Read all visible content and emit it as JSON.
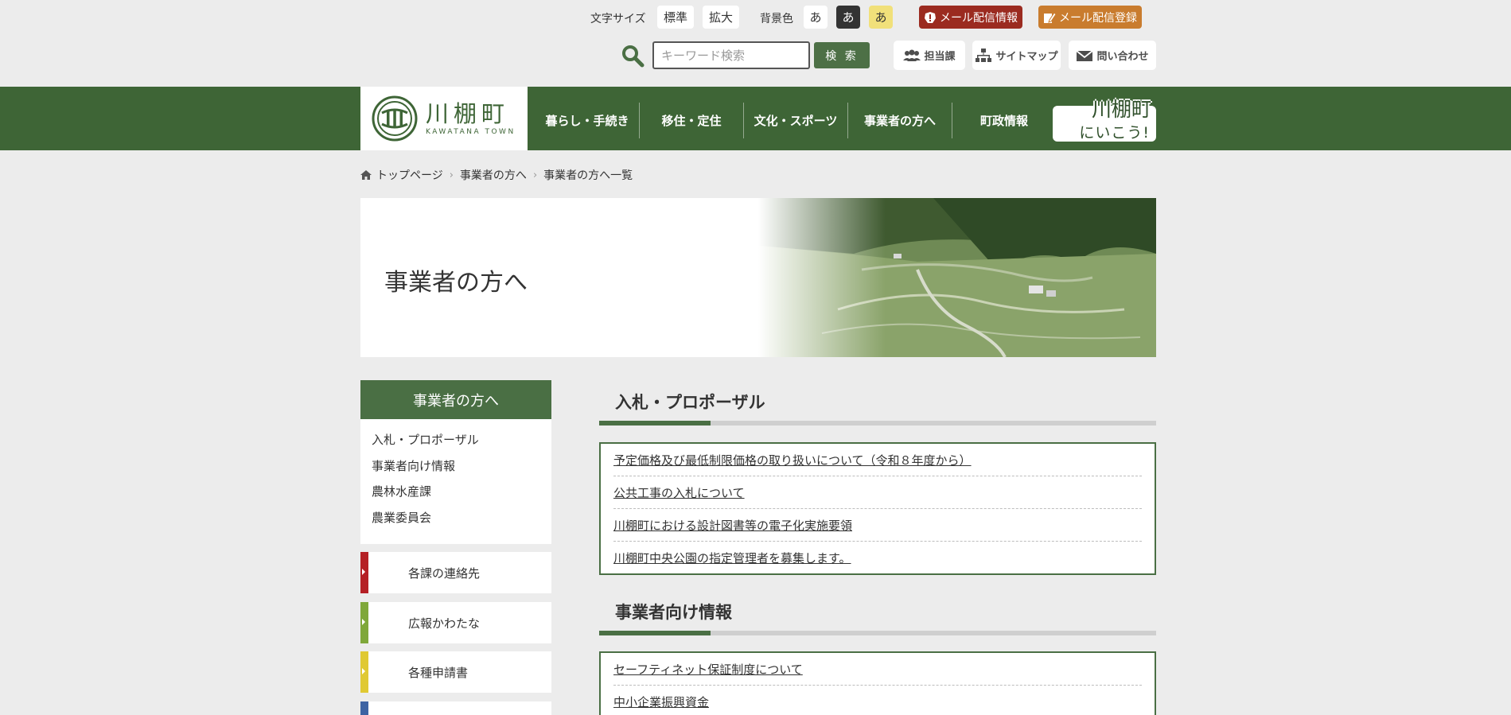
{
  "utility": {
    "font_size_label": "文字サイズ",
    "font_standard": "標準",
    "font_large": "拡大",
    "bg_color_label": "背景色",
    "bg_options": [
      "あ",
      "あ",
      "あ"
    ],
    "mail_info": "メール配信情報",
    "mail_register": "メール配信登録",
    "search_placeholder": "キーワード検索",
    "search_button": "検 索",
    "tools": [
      "担当課",
      "サイトマップ",
      "問い合わせ"
    ]
  },
  "logo": {
    "ja": "川棚町",
    "en": "KAWATANA TOWN"
  },
  "nav": {
    "items": [
      "暮らし・手続き",
      "移住・定住",
      "文化・スポーツ",
      "事業者の方へ",
      "町政情報"
    ],
    "banner_line1": "川棚町",
    "banner_line2": "にいこう!"
  },
  "breadcrumb": [
    "トップページ",
    "事業者の方へ",
    "事業者の方へ一覧"
  ],
  "hero": {
    "title": "事業者の方へ"
  },
  "sidebar": {
    "heading": "事業者の方へ",
    "items": [
      "入札・プロポーザル",
      "事業者向け情報",
      "農林水産課",
      "農業委員会"
    ],
    "boxes": [
      {
        "label": "各課の連絡先",
        "color": "#b52025"
      },
      {
        "label": "広報かわたな",
        "color": "#7fa83a"
      },
      {
        "label": "各種申請書",
        "color": "#e0c933"
      },
      {
        "label": "",
        "color": "#3d63a3"
      }
    ]
  },
  "sections": [
    {
      "title": "入札・プロポーザル",
      "links": [
        "予定価格及び最低制限価格の取り扱いについて（令和８年度から）",
        "公共工事の入札について",
        "川棚町における設計図書等の電子化実施要領",
        "川棚町中央公園の指定管理者を募集します。"
      ]
    },
    {
      "title": "事業者向け情報",
      "links": [
        "セーフティネット保証制度について",
        "中小企業振興資金"
      ]
    }
  ],
  "colors": {
    "brand_green": "#3e6536",
    "accent_green": "#4a6f44",
    "mail_red": "#9b2b20",
    "mail_orange": "#c97c2e"
  }
}
